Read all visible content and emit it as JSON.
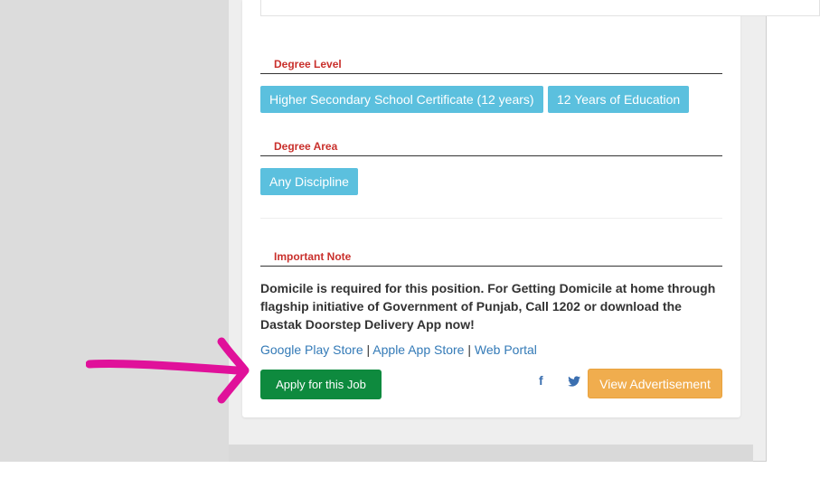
{
  "degree_level": {
    "title": "Degree Level",
    "tags": [
      "Higher Secondary School Certificate (12 years)",
      "12 Years of Education"
    ]
  },
  "degree_area": {
    "title": "Degree Area",
    "tags": [
      "Any Discipline"
    ]
  },
  "important_note": {
    "title": "Important Note",
    "text": "Domicile is required for this position. For Getting Domicile at home through flagship initiative of Government of Punjab, Call 1202 or download the Dastak Doorstep Delivery App now!",
    "links": [
      "Google Play Store",
      "Apple App Store",
      "Web Portal"
    ],
    "separator": " | "
  },
  "actions": {
    "apply_label": "Apply for this Job",
    "facebook_glyph": "f",
    "view_label": "View Advertisement"
  },
  "icons": {
    "facebook": "facebook-icon",
    "twitter": "twitter-icon",
    "annotation": "arrow-annotation"
  },
  "colors": {
    "tag": "#5bc0de",
    "apply": "#0e8a3e",
    "view": "#f0ad4e",
    "section_title": "#c9302c",
    "arrow": "#e0119a"
  }
}
